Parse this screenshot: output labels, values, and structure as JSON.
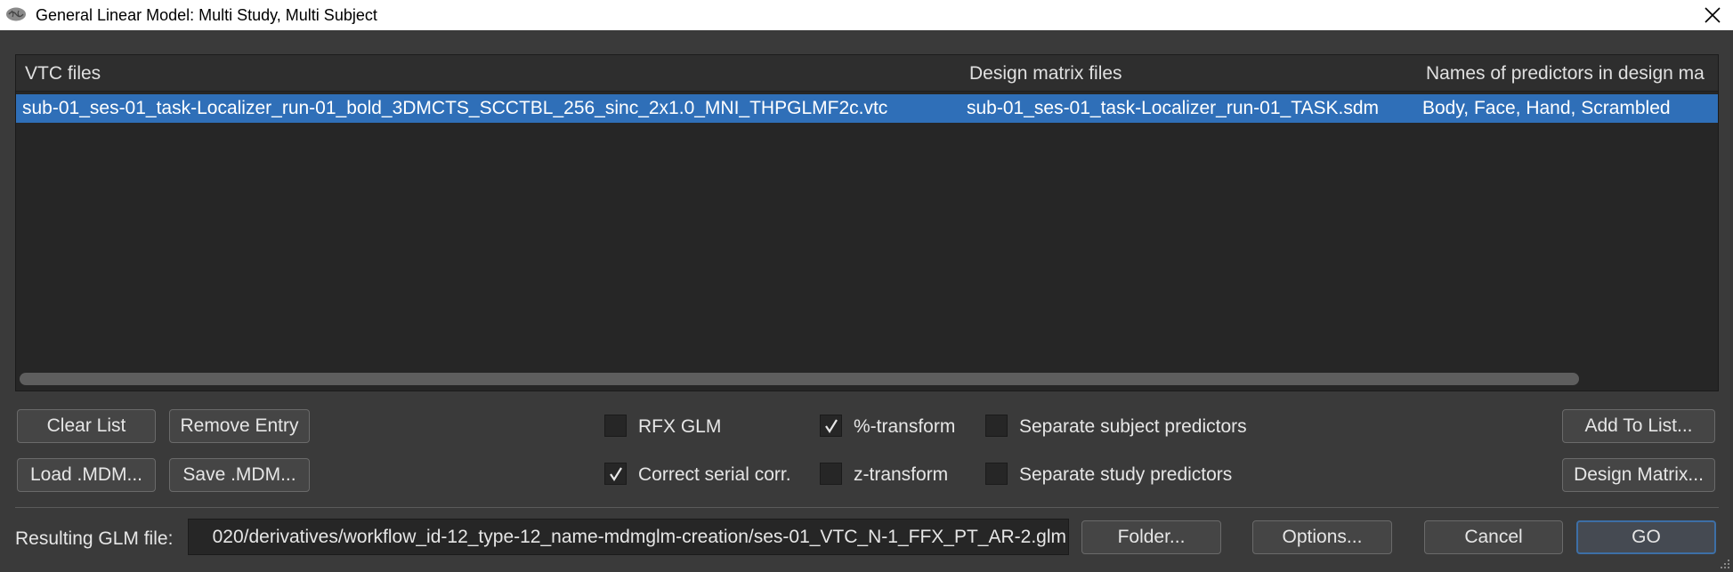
{
  "window": {
    "title": "General Linear Model: Multi Study, Multi Subject",
    "app_icon": "brain-icon",
    "close_icon": "close-icon"
  },
  "table": {
    "columns": [
      "VTC files",
      "Design matrix files",
      "Names of predictors in design ma"
    ],
    "rows": [
      {
        "vtc": "sub-01_ses-01_task-Localizer_run-01_bold_3DMCTS_SCCTBL_256_sinc_2x1.0_MNI_THPGLMF2c.vtc",
        "sdm": "sub-01_ses-01_task-Localizer_run-01_TASK.sdm",
        "predictors": "Body, Face, Hand, Scrambled",
        "selected": true
      }
    ]
  },
  "buttons": {
    "clear_list": "Clear List",
    "remove_entry": "Remove Entry",
    "load_mdm": "Load .MDM...",
    "save_mdm": "Save .MDM...",
    "add_to_list": "Add To List...",
    "design_matrix": "Design Matrix...",
    "folder": "Folder...",
    "options": "Options...",
    "cancel": "Cancel",
    "go": "GO"
  },
  "options": {
    "rfx_glm": {
      "label": "RFX GLM",
      "checked": false
    },
    "correct_serial": {
      "label": "Correct serial corr.",
      "checked": true
    },
    "percent_transform": {
      "label": "%-transform",
      "checked": true
    },
    "z_transform": {
      "label": "z-transform",
      "checked": false
    },
    "separate_subject": {
      "label": "Separate subject predictors",
      "checked": false
    },
    "separate_study": {
      "label": "Separate study predictors",
      "checked": false
    }
  },
  "output": {
    "label": "Resulting GLM file:",
    "value": "020/derivatives/workflow_id-12_type-12_name-mdmglm-creation/ses-01_VTC_N-1_FFX_PT_AR-2.glm"
  },
  "colors": {
    "background": "#3a3a3a",
    "table_bg": "#262626",
    "selection": "#2f6fb8",
    "button_bg": "#454545",
    "primary_border": "#3d6fa6"
  }
}
